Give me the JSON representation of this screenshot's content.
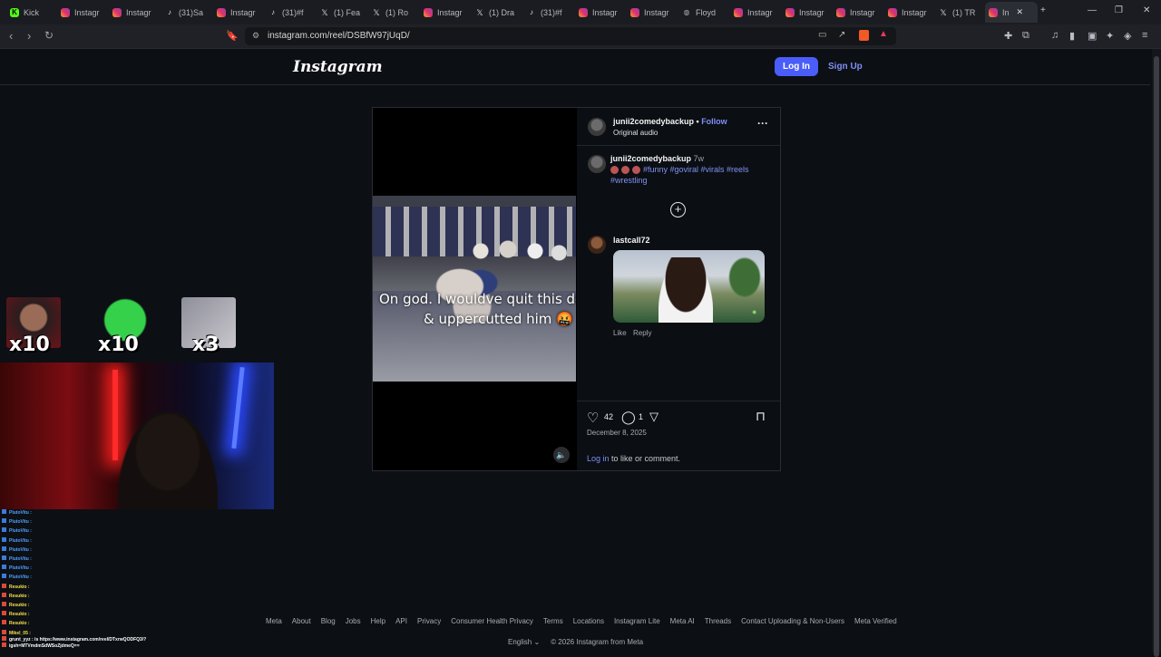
{
  "browser": {
    "tabs": [
      {
        "label": "Kick",
        "fav": "kick",
        "favicon": "kick-icon"
      },
      {
        "label": "Instagr",
        "fav": "ig",
        "favicon": "instagram-icon"
      },
      {
        "label": "Instagr",
        "fav": "ig",
        "favicon": "instagram-icon"
      },
      {
        "label": "(31)Sa",
        "fav": "tt",
        "favicon": "tiktok-icon"
      },
      {
        "label": "Instagr",
        "fav": "ig",
        "favicon": "instagram-icon"
      },
      {
        "label": "(31)#f",
        "fav": "tt",
        "favicon": "tiktok-icon"
      },
      {
        "label": "(1) Fea",
        "fav": "x",
        "favicon": "x-icon"
      },
      {
        "label": "(1) Ro",
        "fav": "x",
        "favicon": "x-icon"
      },
      {
        "label": "Instagr",
        "fav": "ig",
        "favicon": "instagram-icon"
      },
      {
        "label": "(1) Dra",
        "fav": "x",
        "favicon": "x-icon"
      },
      {
        "label": "(31)#f",
        "fav": "tt",
        "favicon": "tiktok-icon"
      },
      {
        "label": "Instagr",
        "fav": "ig",
        "favicon": "instagram-icon"
      },
      {
        "label": "Instagr",
        "fav": "ig",
        "favicon": "instagram-icon"
      },
      {
        "label": "Floyd",
        "fav": "globe",
        "favicon": "globe-icon"
      },
      {
        "label": "Instagr",
        "fav": "ig",
        "favicon": "instagram-icon"
      },
      {
        "label": "Instagr",
        "fav": "ig",
        "favicon": "instagram-icon"
      },
      {
        "label": "Instagr",
        "fav": "ig",
        "favicon": "instagram-icon"
      },
      {
        "label": "Instagr",
        "fav": "ig",
        "favicon": "instagram-icon"
      },
      {
        "label": "(1) TR",
        "fav": "x",
        "favicon": "x-icon"
      },
      {
        "label": "In",
        "fav": "ig",
        "favicon": "instagram-icon",
        "active": true
      }
    ],
    "new_tab_symbol": "+",
    "close_tab_symbol": "✕",
    "url": "instagram.com/reel/DSBfW97jUqD/"
  },
  "header": {
    "logo": "Instagram",
    "login_label": "Log In",
    "signup_label": "Sign Up"
  },
  "video": {
    "caption_line1": "On god. I wouldve quit this doubl",
    "caption_line2": "& uppercutted him 🤬"
  },
  "post": {
    "username": "junii2comedybackup",
    "follow_label": "Follow",
    "audio_label": "Original audio",
    "more_symbol": "···",
    "caption_user": "junii2comedybackup",
    "caption_time": "7w",
    "hashtags": "#funny #goviral #virals #reels #wrestling",
    "comment": {
      "user": "lastcall72",
      "like_label": "Like",
      "reply_label": "Reply"
    },
    "likes": "42",
    "comments": "1",
    "date": "December 8, 2025",
    "login_link": "Log in",
    "login_suffix": " to like or comment."
  },
  "overlay": {
    "counts": [
      "x10",
      "x10",
      "x3"
    ]
  },
  "chat": [
    {
      "text": "PlutoVitu :",
      "color": "#4fa3ff"
    },
    {
      "text": "PlutoVitu :",
      "color": "#4fa3ff"
    },
    {
      "text": "PlutoVitu :",
      "color": "#4fa3ff"
    },
    {
      "text": "PlutoVitu :",
      "color": "#4fa3ff"
    },
    {
      "text": "PlutoVitu :",
      "color": "#4fa3ff"
    },
    {
      "text": "PlutoVitu :",
      "color": "#4fa3ff"
    },
    {
      "text": "PlutoVitu :",
      "color": "#4fa3ff"
    },
    {
      "text": "PlutoVitu :",
      "color": "#4fa3ff"
    },
    {
      "text": "Resukio :",
      "color": "#f3e04a"
    },
    {
      "text": "Resukio :",
      "color": "#f3e04a"
    },
    {
      "text": "Resukio :",
      "color": "#f3e04a"
    },
    {
      "text": "Resukio :",
      "color": "#f3e04a"
    },
    {
      "text": "Resukio :",
      "color": "#f3e04a"
    },
    {
      "text": "Mikel_05 :",
      "color": "#f3e04a"
    },
    {
      "text": "grunt_yyz : is https://www.instagram.com/reel/DTxrwQODFQ3/?",
      "color": "#ffffff"
    },
    {
      "text": "igsh=MTVmdmSdWSoZjdmeQ==",
      "color": "#ffffff"
    }
  ],
  "footer": {
    "links": [
      "Meta",
      "About",
      "Blog",
      "Jobs",
      "Help",
      "API",
      "Privacy",
      "Consumer Health Privacy",
      "Terms",
      "Locations",
      "Instagram Lite",
      "Meta AI",
      "Threads",
      "Contact Uploading & Non-Users",
      "Meta Verified"
    ],
    "language": "English",
    "copyright": "© 2026 Instagram from Meta"
  },
  "colors": {
    "accent": "#4a5df9",
    "link": "#7f8ff5",
    "background": "#0c0f14"
  }
}
